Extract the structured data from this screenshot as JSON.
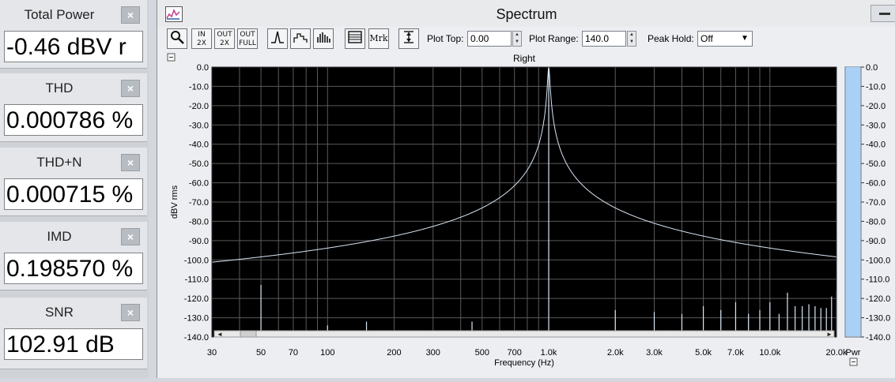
{
  "meters": [
    {
      "title": "Total Power",
      "value": "-0.46 dBV r"
    },
    {
      "title": "THD",
      "value": "0.000786 %"
    },
    {
      "title": "THD+N",
      "value": "0.000715 %"
    },
    {
      "title": "IMD",
      "value": "0.198570 %"
    },
    {
      "title": "SNR",
      "value": "102.91 dB"
    }
  ],
  "close_glyph": "×",
  "window": {
    "title": "Spectrum"
  },
  "toolbar": {
    "buttons": [
      "zoom",
      "in 2x",
      "out 2x",
      "out full",
      "line",
      "bar outline",
      "bar filled",
      "table",
      "Mrk",
      "scale"
    ],
    "mrk_label": "Mrk",
    "plot_top_label": "Plot Top:",
    "plot_top_value": "0.00",
    "plot_range_label": "Plot Range:",
    "plot_range_value": "140.0",
    "peak_hold_label": "Peak Hold:",
    "peak_hold_value": "Off"
  },
  "chart_data": {
    "type": "line",
    "title": "Right",
    "xlabel": "Frequency (Hz)",
    "ylabel": "dBV rms",
    "xscale": "log",
    "xlim": [
      30,
      20000
    ],
    "ylim": [
      -140,
      0
    ],
    "grid": true,
    "background": "#000000",
    "trace_color": "#d8e6f5",
    "x_ticks": [
      "30",
      "50",
      "70",
      "100",
      "200",
      "300",
      "500",
      "700",
      "1.0k",
      "2.0k",
      "3.0k",
      "5.0k",
      "7.0k",
      "10.0k",
      "20.0k"
    ],
    "y_ticks": [
      "0.0",
      "-10.0",
      "-20.0",
      "-30.0",
      "-40.0",
      "-50.0",
      "-60.0",
      "-70.0",
      "-80.0",
      "-90.0",
      "-100.0",
      "-110.0",
      "-120.0",
      "-130.0",
      "-140.0"
    ],
    "noise_floor": -139,
    "peaks": [
      {
        "freq": 50,
        "level": -113
      },
      {
        "freq": 100,
        "level": -134
      },
      {
        "freq": 150,
        "level": -132
      },
      {
        "freq": 450,
        "level": -132
      },
      {
        "freq": 1000,
        "level": 0
      },
      {
        "freq": 2000,
        "level": -126
      },
      {
        "freq": 3000,
        "level": -127
      },
      {
        "freq": 4000,
        "level": -128
      },
      {
        "freq": 5000,
        "level": -124
      },
      {
        "freq": 6000,
        "level": -126
      },
      {
        "freq": 7000,
        "level": -122
      },
      {
        "freq": 8000,
        "level": -128
      },
      {
        "freq": 9000,
        "level": -126
      },
      {
        "freq": 10000,
        "level": -122
      },
      {
        "freq": 11000,
        "level": -128
      },
      {
        "freq": 12000,
        "level": -117
      },
      {
        "freq": 13000,
        "level": -124
      },
      {
        "freq": 14000,
        "level": -124
      },
      {
        "freq": 15000,
        "level": -123
      },
      {
        "freq": 16000,
        "level": -124
      },
      {
        "freq": 17000,
        "level": -125
      },
      {
        "freq": 18000,
        "level": -125
      },
      {
        "freq": 19000,
        "level": -119
      },
      {
        "freq": 20000,
        "level": -116
      }
    ],
    "power_meter": {
      "label": "Pwr",
      "ticks": [
        "0.0",
        "-10.0",
        "-20.0",
        "-30.0",
        "-40.0",
        "-50.0",
        "-60.0",
        "-70.0",
        "-80.0",
        "-90.0",
        "-100.0",
        "-110.0",
        "-120.0",
        "-130.0",
        "-140.0"
      ],
      "level": 0,
      "fill_color": "#a9d1f5"
    }
  }
}
